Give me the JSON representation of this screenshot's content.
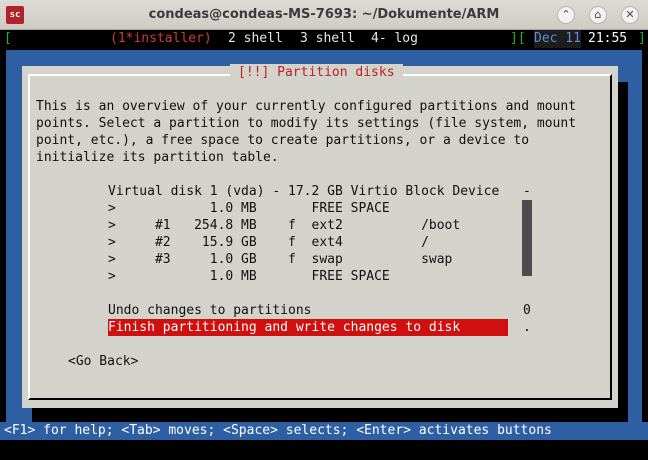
{
  "window": {
    "title": "condeas@condeas-MS-7693: ~/Dokumente/ARM",
    "icon_text": "sc"
  },
  "tmux": {
    "open_bracket": "[",
    "windows": [
      {
        "label": "(1*installer)",
        "active": true
      },
      {
        "label": "2 shell",
        "active": false
      },
      {
        "label": "3 shell",
        "active": false
      },
      {
        "label": "4- log",
        "active": false
      }
    ],
    "close_bracket": "][",
    "date": "Dec 11",
    "time": "21:55",
    "end_bracket": "]"
  },
  "dialog": {
    "title": "[!!] Partition disks",
    "intro_lines": [
      "This is an overview of your currently configured partitions and mount",
      "points. Select a partition to modify its settings (file system, mount",
      "point, etc.), a free space to create partitions, or a device to",
      "initialize its partition table."
    ],
    "list": [
      "Virtual disk 1 (vda) - 17.2 GB Virtio Block Device",
      ">            1.0 MB       FREE SPACE",
      ">     #1   254.8 MB    f  ext2          /boot",
      ">     #2    15.9 GB    f  ext4          /",
      ">     #3     1.0 GB    f  swap          swap",
      ">            1.0 MB       FREE SPACE"
    ],
    "undo_label": "Undo changes to partitions",
    "finish_label": "Finish partitioning and write changes to disk",
    "go_back_label": "<Go Back>",
    "scroll_marks": [
      "-",
      "0",
      "."
    ]
  },
  "help_text": "<F1> for help; <Tab> moves; <Space> selects; <Enter> activates buttons",
  "colors": {
    "installer_blue": "#2f5fa3",
    "dialog_grey": "#d3d3cc",
    "selection_red": "#d00f0f",
    "tmux_green": "#1fb41f"
  }
}
